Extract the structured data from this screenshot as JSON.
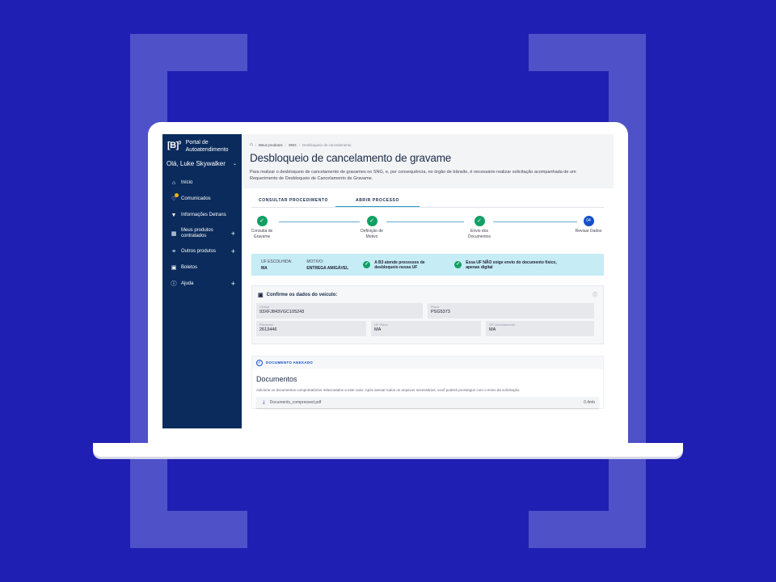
{
  "brand": {
    "logo_text": "B",
    "logo_sup": "3",
    "portal_title": "Portal de Autoatendimento"
  },
  "user": {
    "greeting": "Olá, Luke Skywalker"
  },
  "sidebar": {
    "items": [
      {
        "label": "Início",
        "icon": "home-icon"
      },
      {
        "label": "Comunicados",
        "icon": "bell-icon"
      },
      {
        "label": "Informações Detrans",
        "icon": "map-icon"
      },
      {
        "label": "Meus produtos contratados",
        "icon": "grid-icon",
        "expandable": "+"
      },
      {
        "label": "Outros produtos",
        "icon": "list-icon",
        "expandable": "+"
      },
      {
        "label": "Boletos",
        "icon": "ticket-icon"
      },
      {
        "label": "Ajuda",
        "icon": "help-icon",
        "expandable": "+"
      }
    ]
  },
  "breadcrumb": [
    "Meus produtos",
    "SNG",
    "Desbloqueio de cancelamento"
  ],
  "page": {
    "title": "Desbloqueio de cancelamento de gravame",
    "description": "Para realizar o desbloqueio de cancelamento de gravames no SNG, e, por consequência, no órgão de trânsito, é necessário realizar solicitação acompanhada de um Requerimento de Desbloqueio de Cancelamento de Gravame."
  },
  "tabs": [
    "CONSULTAR PROCEDIMENTO",
    "ABRIR PROCESSO"
  ],
  "active_tab": 1,
  "steps": [
    {
      "label": "Consulta de Gravame",
      "status": "done"
    },
    {
      "label": "Definição de Motivo",
      "status": "done"
    },
    {
      "label": "Envio dos Documentos",
      "status": "done"
    },
    {
      "label": "Revisar Dados",
      "status": "current",
      "number": "04"
    }
  ],
  "info_bar": {
    "uf_label": "UF ESCOLHIDA:",
    "uf_value": "MA",
    "motivo_label": "MOTIVO:",
    "motivo_value": "ENTREGA AMIGÁVEL",
    "notice1": "A B3 atende processos de desbloqueio nessa UF",
    "notice2": "Essa UF NÃO exige envio do documento físico, apenas digital"
  },
  "vehicle": {
    "title": "Confirme os dados do veículo:",
    "fields": [
      {
        "label": "Chassi",
        "value": "93XFJ843VGC105243"
      },
      {
        "label": "Placa",
        "value": "PSG5373"
      },
      {
        "label": "Renavam",
        "value": "2613446"
      },
      {
        "label": "UF Placa",
        "value": "MA"
      },
      {
        "label": "UF Licenciamento",
        "value": "MA"
      }
    ]
  },
  "documents": {
    "status": "DOCUMENTO ANEXADO",
    "title": "Documentos",
    "description": "Adicione os documentos comprobatórios relacionados a este caso. Após anexar todos os arquivos necessários, você poderá prosseguir com o envio da solicitação.",
    "file_name": "Documents_compressed.pdf",
    "file_size": "0.4mb"
  },
  "colors": {
    "background": "#1f1fb3",
    "sidebar": "#0a2b5c",
    "success": "#10a064",
    "primary": "#1450c8",
    "info": "#c6ecf6"
  }
}
